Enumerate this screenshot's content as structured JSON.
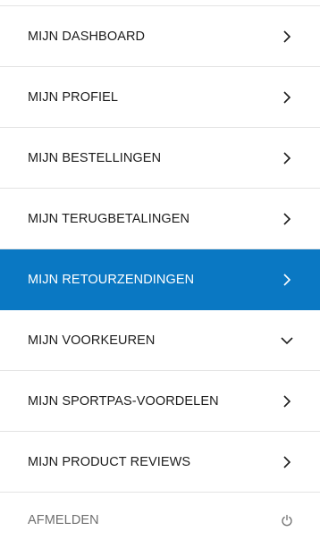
{
  "menu": {
    "items": [
      {
        "label": "MIJN DASHBOARD",
        "icon": "chevron-right-icon",
        "active": false
      },
      {
        "label": "MIJN PROFIEL",
        "icon": "chevron-right-icon",
        "active": false
      },
      {
        "label": "MIJN BESTELLINGEN",
        "icon": "chevron-right-icon",
        "active": false
      },
      {
        "label": "MIJN TERUGBETALINGEN",
        "icon": "chevron-right-icon",
        "active": false
      },
      {
        "label": "MIJN RETOURZENDINGEN",
        "icon": "chevron-right-icon",
        "active": true
      },
      {
        "label": "MIJN VOORKEUREN",
        "icon": "chevron-down-icon",
        "active": false
      },
      {
        "label": "MIJN SPORTPAS-VOORDELEN",
        "icon": "chevron-right-icon",
        "active": false
      },
      {
        "label": "MIJN PRODUCT REVIEWS",
        "icon": "chevron-right-icon",
        "active": false
      }
    ],
    "logout": {
      "label": "AFMELDEN",
      "icon": "power-icon"
    }
  },
  "colors": {
    "active_background": "#0a78c3",
    "text": "#1c1c1c",
    "muted_text": "#6f6f6f",
    "divider": "#e3e3e3"
  }
}
